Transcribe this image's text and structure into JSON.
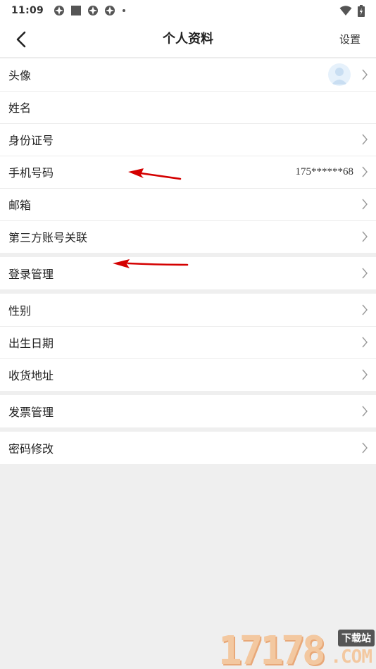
{
  "status_bar": {
    "time": "11:09"
  },
  "header": {
    "title": "个人资料",
    "settings_label": "设置"
  },
  "groups": [
    [
      {
        "label": "头像",
        "value": ""
      },
      {
        "label": "姓名",
        "value": ""
      },
      {
        "label": "身份证号",
        "value": ""
      },
      {
        "label": "手机号码",
        "value": "175******68"
      },
      {
        "label": "邮箱",
        "value": ""
      },
      {
        "label": "第三方账号关联",
        "value": ""
      }
    ],
    [
      {
        "label": "登录管理",
        "value": ""
      }
    ],
    [
      {
        "label": "性别",
        "value": ""
      },
      {
        "label": "出生日期",
        "value": ""
      },
      {
        "label": "收货地址",
        "value": ""
      }
    ],
    [
      {
        "label": "发票管理",
        "value": ""
      }
    ],
    [
      {
        "label": "密码修改",
        "value": ""
      }
    ]
  ],
  "watermark": {
    "digits": "17178",
    "badge": "下载站",
    "suffix": ".COM"
  },
  "colors": {
    "background": "#efefef",
    "annotation_arrow": "#d40000",
    "avatar_bg": "#e6f1fb"
  }
}
